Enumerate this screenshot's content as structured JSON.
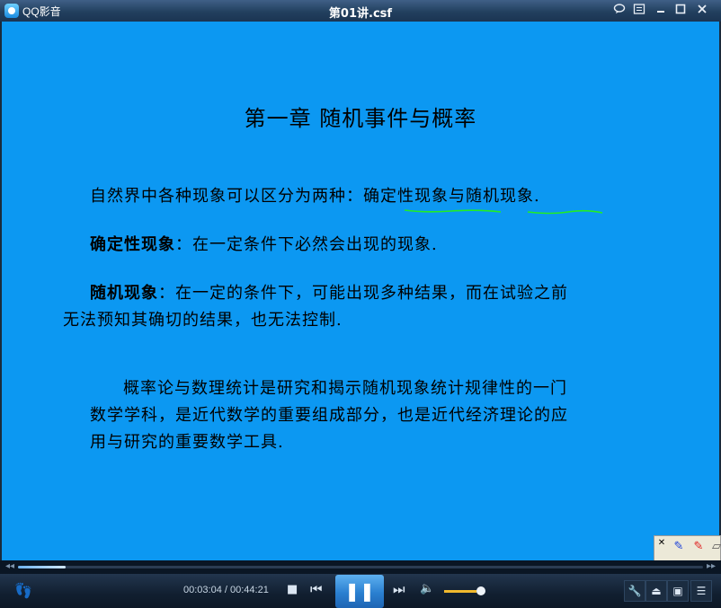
{
  "titlebar": {
    "app_name": "QQ影音",
    "window_title": "第01讲.csf",
    "icons": [
      "app-logo-icon",
      "speech-bubble-icon",
      "menu-icon",
      "minimize-icon",
      "maximize-icon",
      "close-icon"
    ]
  },
  "slide": {
    "title": "第一章  随机事件与概率",
    "line1": "自然界中各种现象可以区分为两种：确定性现象与随机现象.",
    "line2_term": "确定性现象",
    "line2_text": "：在一定条件下必然会出现的现象.",
    "line3_term": "随机现象",
    "line3_text": "：在一定的条件下，可能出现多种结果，而在试验之前",
    "line3_cont": "无法预知其确切的结果，也无法控制.",
    "line4a": "概率论与数理统计是研究和揭示随机现象统计规律性的一门",
    "line4b": "数学学科，是近代数学的重要组成部分，也是近代经济理论的应",
    "line4c": "用与研究的重要数学工具.",
    "ink_color": "#22ee22"
  },
  "pen_toolbar": {
    "icons": [
      "close-icon",
      "blue-pen-icon",
      "red-pen-icon",
      "eraser-icon"
    ],
    "close_glyph": "✕",
    "blue_pen_glyph": "✎",
    "red_pen_glyph": "✎",
    "eraser_glyph": "▱"
  },
  "player": {
    "current_time": "00:03:04",
    "separator": " / ",
    "total_time": "00:44:21",
    "progress_fraction": 0.069,
    "volume_fraction": 0.85,
    "seek_back_glyph": "◂◂",
    "seek_forward_glyph": "▸▸",
    "stop_glyph": "■",
    "prev_glyph": "⏮",
    "play_pause_glyph": "❚❚",
    "next_glyph": "⏭",
    "volume_glyph": "🔈",
    "foot_glyph": "👣",
    "tools_glyph": "🔧",
    "eject_glyph": "⏏",
    "screen_glyph": "▣",
    "playlist_glyph": "☰"
  },
  "colors": {
    "video_bg": "#0c98f2",
    "play_button": "#2a7fd0",
    "volume": "#f0b92e"
  }
}
